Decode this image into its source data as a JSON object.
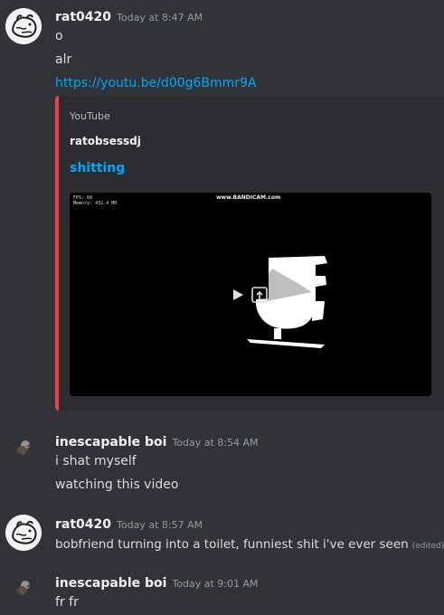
{
  "messages": [
    {
      "username": "rat0420",
      "timestamp": "Today at 8:47 AM",
      "lines": [
        "o",
        "alr"
      ],
      "link": "https://youtu.be/d00g6Bmmr9A"
    },
    {
      "username": "inescapable boi",
      "timestamp": "Today at 8:54 AM",
      "lines": [
        "i shat myself",
        "watching this video"
      ]
    },
    {
      "username": "rat0420",
      "timestamp": "Today at 8:57 AM",
      "lines": [
        "bobfriend turning into a toilet, funniest shit i've ever seen"
      ],
      "edited": "(edited)"
    },
    {
      "username": "inescapable boi",
      "timestamp": "Today at 9:01 AM",
      "lines": [
        "fr fr"
      ]
    }
  ],
  "embed": {
    "provider": "YouTube",
    "author": "ratobsessdj",
    "title": "shitting",
    "accent": "#f23f43",
    "video_overlay": {
      "fps": "FPS: 60",
      "memory": "Memory: 432.4 MB",
      "watermark": "www.BANDICAM.com"
    }
  },
  "colors": {
    "background": "#313338",
    "link": "#00a8fc",
    "username": "#f2f3f5",
    "timestamp": "#949ba4"
  },
  "icons": {
    "rat_avatar": "rat-avatar",
    "spider_avatar": "spider-avatar",
    "play": "play-icon",
    "watch_external": "external-link-icon"
  }
}
